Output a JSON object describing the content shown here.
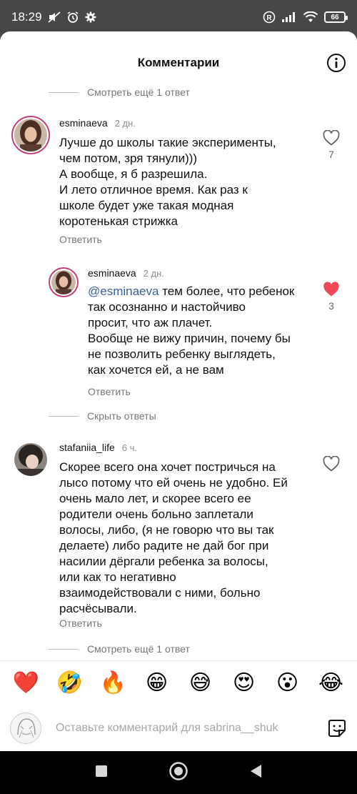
{
  "status_bar": {
    "time": "18:29",
    "battery": "66",
    "icons": [
      "muted-icon",
      "alarm-icon",
      "gear-icon",
      "registered-icon",
      "signal-icon",
      "wifi-icon",
      "battery-icon"
    ]
  },
  "header": {
    "title": "Комментарии",
    "info_icon": "info-icon"
  },
  "thread": {
    "view_more_top": "Смотреть ещё 1 ответ",
    "hide_replies": "Скрыть ответы",
    "view_more_bottom": "Смотреть ещё 1 ответ"
  },
  "comments": [
    {
      "username": "esminaeva",
      "time": "2 дн.",
      "lines": [
        "Лучше до школы такие эксперименты,",
        "чем потом, зря тянули)))",
        "А вообще, я б разрешила.",
        "И лето отличное время. Как раз к",
        "школе будет уже такая модная",
        "коротенькая стрижка"
      ],
      "reply_label": "Ответить",
      "likes": "7",
      "liked": false
    },
    {
      "username": "esminaeva",
      "time": "2 дн.",
      "mention": "@esminaeva",
      "lines": [
        " тем более, что ребенок",
        "так осознанно и настойчиво",
        "просит, что аж плачет.",
        "Вообще не вижу причин, почему бы",
        "не позволить ребенку выглядеть,",
        "как хочется ей, а не вам"
      ],
      "reply_label": "Ответить",
      "likes": "3",
      "liked": true
    },
    {
      "username": "stafaniia_life",
      "time": "6 ч.",
      "lines": [
        "Скорее всего она хочет постричься на",
        "лысо потому что ей очень не удобно. Ей",
        "очень мало лет, и скорее всего ее",
        "родители очень больно заплетали",
        "волосы, либо, (я не говорю что вы так",
        "делаете) либо радите не дай бог при",
        "насилии дёргали ребенка за волосы,",
        "или как то негативно",
        "взаимодействовали с ними, больно",
        "расчёсывали."
      ],
      "reply_label": "Ответить",
      "liked": false
    }
  ],
  "emoji_bar": [
    "❤️",
    "🤣",
    "🔥",
    "😁",
    "😅",
    "😍",
    "😮",
    "😂"
  ],
  "input": {
    "placeholder": "Оставьте комментарий для sabrina__shuk",
    "value": ""
  },
  "colors": {
    "like_red": "#ed4956",
    "mention_blue": "#3b5f99",
    "ring": "#c2407a"
  }
}
